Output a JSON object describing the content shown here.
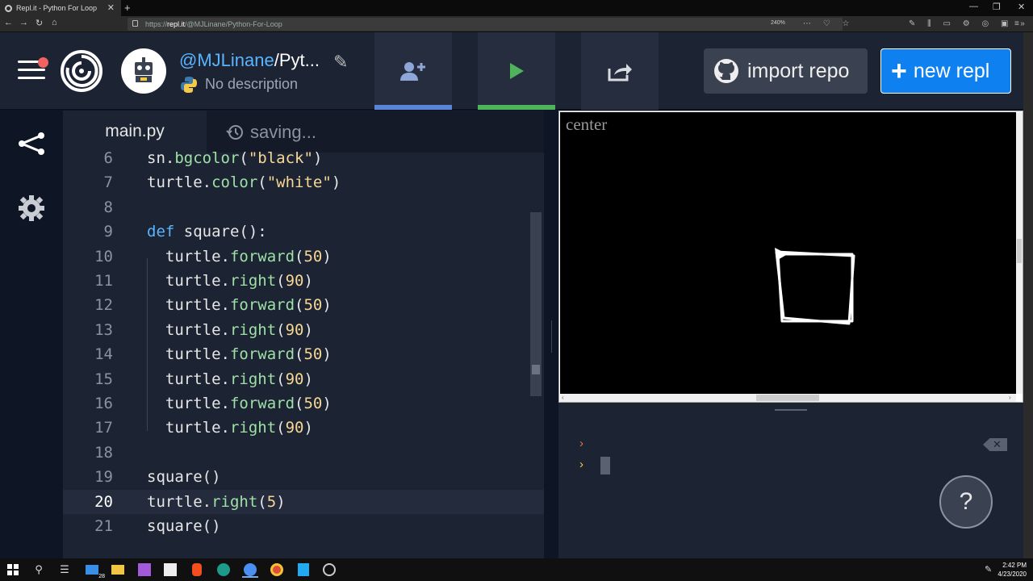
{
  "browser": {
    "tab_title": "Repl.it - Python For Loop",
    "url_prefix": "https://",
    "url_host": "repl.it",
    "url_path": "/@MJLinane/Python-For-Loop",
    "zoom": "240%"
  },
  "header": {
    "owner": "@MJLinane",
    "repl_name": "/Pyt...",
    "description": "No description",
    "import_label": "import repo",
    "new_label": "new repl",
    "accent_run": "#4fb35c",
    "accent_invite": "#5b84d6",
    "accent_new": "#0f80f0"
  },
  "editor": {
    "file_tab": "main.py",
    "status": "saving...",
    "lines": [
      {
        "n": "6",
        "text": "sn.bgcolor(\"black\")"
      },
      {
        "n": "7",
        "text": "turtle.color(\"white\")"
      },
      {
        "n": "8",
        "text": ""
      },
      {
        "n": "9",
        "text": "def square():"
      },
      {
        "n": "10",
        "text": "  turtle.forward(50)"
      },
      {
        "n": "11",
        "text": "  turtle.right(90)"
      },
      {
        "n": "12",
        "text": "  turtle.forward(50)"
      },
      {
        "n": "13",
        "text": "  turtle.right(90)"
      },
      {
        "n": "14",
        "text": "  turtle.forward(50)"
      },
      {
        "n": "15",
        "text": "  turtle.right(90)"
      },
      {
        "n": "16",
        "text": "  turtle.forward(50)"
      },
      {
        "n": "17",
        "text": "  turtle.right(90)"
      },
      {
        "n": "18",
        "text": ""
      },
      {
        "n": "19",
        "text": "square()"
      },
      {
        "n": "20",
        "text": "turtle.right(5)"
      },
      {
        "n": "21",
        "text": "square()"
      }
    ],
    "active_line": "20"
  },
  "output": {
    "canvas_title": "center",
    "canvas_bg": "#000000",
    "pen_color": "#ffffff"
  },
  "console": {
    "prompt_1": "›",
    "prompt_2": "›"
  },
  "help": {
    "label": "?"
  },
  "taskbar": {
    "time": "2:42 PM",
    "date": "4/23/2020",
    "mail_badge": "28"
  }
}
